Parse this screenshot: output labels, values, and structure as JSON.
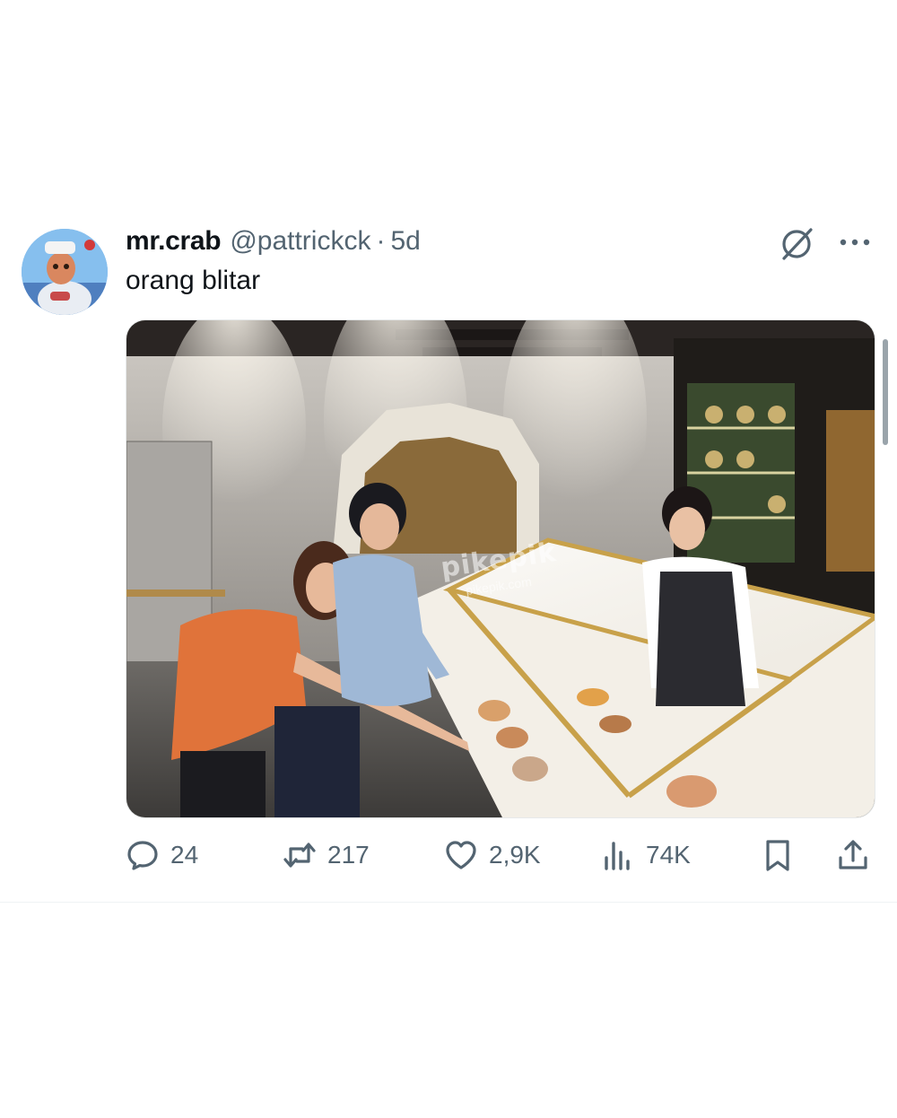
{
  "tweet": {
    "display_name": "mr.crab",
    "handle": "@pattrickck",
    "separator": "·",
    "time": "5d",
    "text": "orang blitar"
  },
  "media": {
    "watermark": "pikepik",
    "watermark_sub": "pikepik.com"
  },
  "actions": {
    "replies": "24",
    "reposts": "217",
    "likes": "2,9K",
    "views": "74K"
  },
  "icons": [
    "grok-icon",
    "more-icon",
    "reply-icon",
    "retweet-icon",
    "heart-icon",
    "views-icon",
    "bookmark-icon",
    "share-icon"
  ],
  "colors": {
    "text_primary": "#0f1419",
    "text_secondary": "#536471",
    "divider": "#eff3f4"
  }
}
